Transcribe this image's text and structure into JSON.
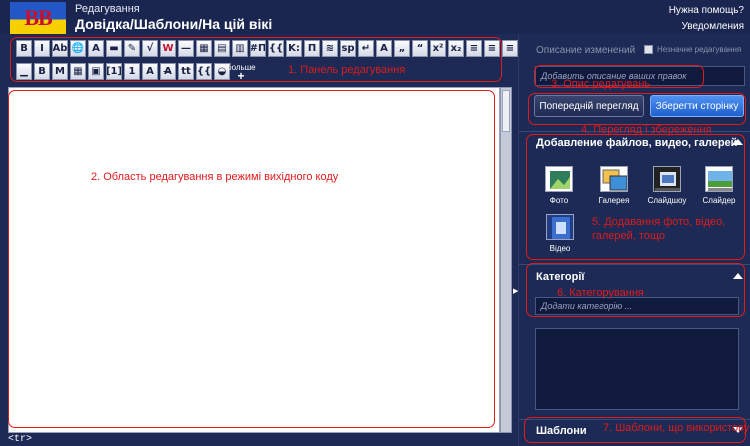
{
  "header": {
    "logo_text": "ВВ",
    "edit_label": "Редагування",
    "page_title": "Довідка/Шаблони/На цій вікі",
    "help_link": "Нужна помощь?",
    "notifications_link": "Уведомления"
  },
  "toolbar": {
    "row1": [
      "B",
      "I",
      "Ab",
      "🌐",
      "A",
      "▬",
      "✎",
      "√",
      "W",
      "—",
      "▦",
      "▤",
      "▥",
      "#П",
      "{{",
      "K:",
      "П",
      "≋",
      "sp",
      "↵",
      "A",
      "„",
      "“",
      "x²",
      "x₂",
      "≡",
      "≡",
      "≡",
      "≡",
      "⊕"
    ],
    "row2": [
      "▁",
      "B",
      "M",
      "▦",
      "▣",
      "[1]",
      "1",
      "A",
      "A̶",
      "tt",
      "{{",
      "◒"
    ],
    "more_label": "больше",
    "more_icon": "+"
  },
  "editor": {
    "tag_footer": "<tr>"
  },
  "sidebar": {
    "summary_label": "Описание изменений",
    "minor_label": "Незначне редагування",
    "summary_placeholder": "Добавить описание ваших правок",
    "preview_button": "Попередній перегляд",
    "save_button": "Зберегти сторінку",
    "media_section": {
      "title": "Добавление файлов, видео, галерей",
      "buttons": [
        "Фото",
        "Галерея",
        "Слайдшоу",
        "Слайдер",
        "Відео"
      ]
    },
    "categories_section": {
      "title": "Категорії",
      "placeholder": "Додати категорію ..."
    },
    "templates_section": {
      "title": "Шаблони"
    }
  },
  "annotations": [
    "1. Панель редагування",
    "2. Область редагування в режимі вихідного коду",
    "3. Опис редагувань",
    "4. Перегляд і збереження",
    "5. Додавання фото, відео, галерей, тощо",
    "6. Категорування",
    "7. Шаблони, що використовуються"
  ],
  "colors": {
    "background": "#1c2a55",
    "annotation": "#e11a1a",
    "save_button": "#2f7de0"
  }
}
